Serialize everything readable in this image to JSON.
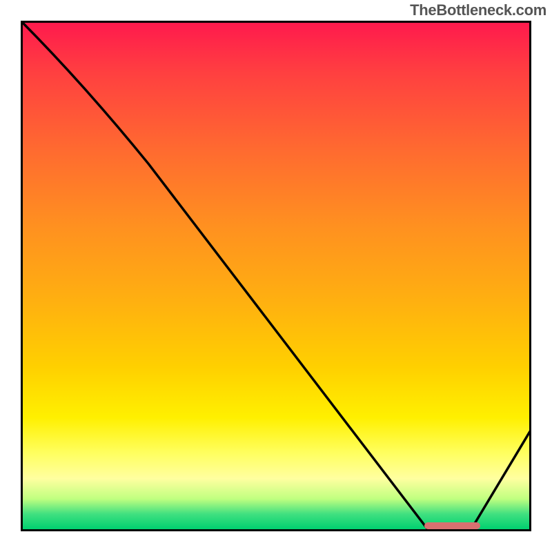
{
  "watermark": "TheBottleneck.com",
  "chart_data": {
    "type": "line",
    "title": "",
    "xlabel": "",
    "ylabel": "",
    "xlim": [
      0,
      100
    ],
    "ylim": [
      0,
      100
    ],
    "x": [
      0,
      25,
      80,
      88,
      100
    ],
    "values": [
      100,
      72,
      0,
      0,
      20
    ],
    "gradient_stops": [
      {
        "pos": 0,
        "color": "#ff1a4d"
      },
      {
        "pos": 10,
        "color": "#ff4040"
      },
      {
        "pos": 25,
        "color": "#ff6a30"
      },
      {
        "pos": 40,
        "color": "#ff9020"
      },
      {
        "pos": 55,
        "color": "#ffb010"
      },
      {
        "pos": 68,
        "color": "#ffd000"
      },
      {
        "pos": 78,
        "color": "#fff000"
      },
      {
        "pos": 85,
        "color": "#ffff60"
      },
      {
        "pos": 90,
        "color": "#ffffa0"
      },
      {
        "pos": 94,
        "color": "#c0ff80"
      },
      {
        "pos": 97,
        "color": "#40e080"
      },
      {
        "pos": 100,
        "color": "#00d070"
      }
    ],
    "marker": {
      "x_start": 79,
      "x_end": 90,
      "y": 0,
      "color": "#d87070"
    }
  }
}
